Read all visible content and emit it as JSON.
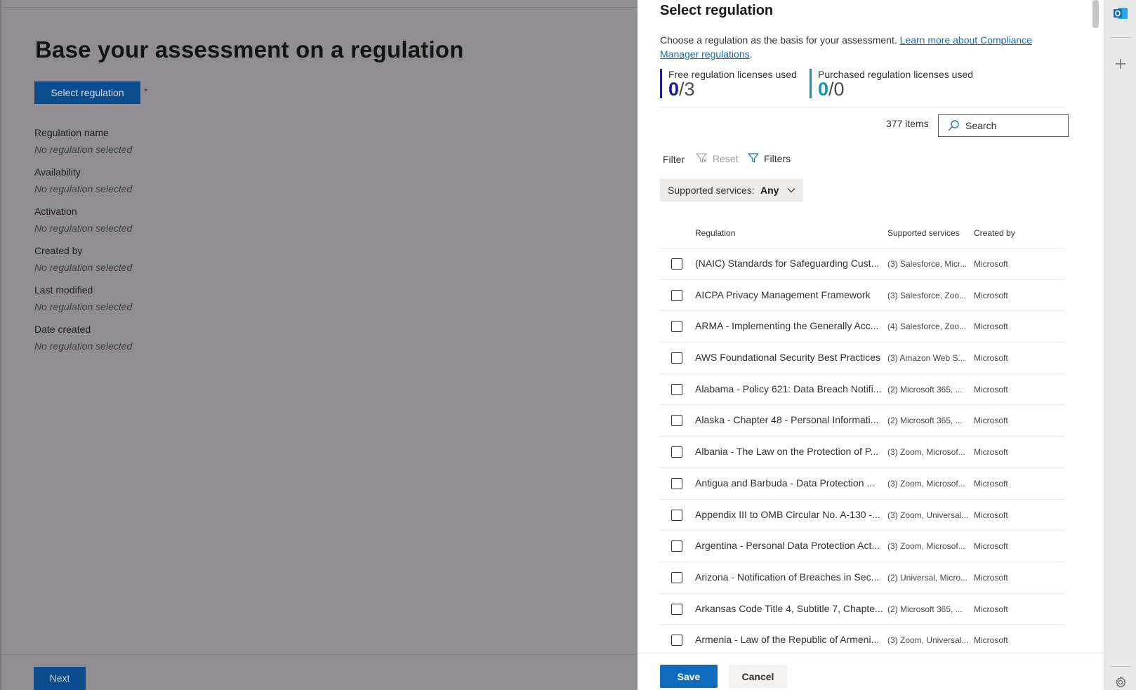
{
  "background": {
    "title": "Base your assessment on a regulation",
    "select_button": "Select regulation",
    "required_marker": "*",
    "fields": [
      {
        "label": "Regulation name",
        "value": "No regulation selected"
      },
      {
        "label": "Availability",
        "value": "No regulation selected"
      },
      {
        "label": "Activation",
        "value": "No regulation selected"
      },
      {
        "label": "Created by",
        "value": "No regulation selected"
      },
      {
        "label": "Last modified",
        "value": "No regulation selected"
      },
      {
        "label": "Date created",
        "value": "No regulation selected"
      }
    ],
    "next_button": "Next"
  },
  "panel": {
    "title": "Select regulation",
    "description": "Choose a regulation as the basis for your assessment.",
    "learn_more_link": "Learn more about Compliance Manager regulations",
    "period": ".",
    "licenses": {
      "free": {
        "label": "Free regulation licenses used",
        "used": "0",
        "total": "/3",
        "color": "#1b1a8f"
      },
      "purchased": {
        "label": "Purchased regulation licenses used",
        "used": "0",
        "total": "/0",
        "color": "#1495b3"
      }
    },
    "items_count": "377 items",
    "search_placeholder": "Search",
    "filter": {
      "label": "Filter",
      "reset": "Reset",
      "filters": "Filters"
    },
    "supported_services_dropdown": {
      "label": "Supported services:",
      "value": "Any"
    },
    "table": {
      "headers": {
        "regulation": "Regulation",
        "services": "Supported services",
        "created_by": "Created by"
      },
      "rows": [
        {
          "regulation": "(NAIC) Standards for Safeguarding Cust...",
          "services": "(3) Salesforce, Micr...",
          "created_by": "Microsoft"
        },
        {
          "regulation": "AICPA Privacy Management Framework",
          "services": "(3) Salesforce, Zoo...",
          "created_by": "Microsoft"
        },
        {
          "regulation": "ARMA - Implementing the Generally Acc...",
          "services": "(4) Salesforce, Zoo...",
          "created_by": "Microsoft"
        },
        {
          "regulation": "AWS Foundational Security Best Practices",
          "services": "(3) Amazon Web S...",
          "created_by": "Microsoft"
        },
        {
          "regulation": "Alabama - Policy 621: Data Breach Notifi...",
          "services": "(2) Microsoft 365, ...",
          "created_by": "Microsoft"
        },
        {
          "regulation": "Alaska - Chapter 48 - Personal Informati...",
          "services": "(2) Microsoft 365, ...",
          "created_by": "Microsoft"
        },
        {
          "regulation": "Albania - The Law on the Protection of P...",
          "services": "(3) Zoom, Microsof...",
          "created_by": "Microsoft"
        },
        {
          "regulation": "Antigua and Barbuda - Data Protection ...",
          "services": "(3) Zoom, Microsof...",
          "created_by": "Microsoft"
        },
        {
          "regulation": "Appendix III to OMB Circular No. A-130 -...",
          "services": "(3) Zoom, Universal...",
          "created_by": "Microsoft"
        },
        {
          "regulation": "Argentina - Personal Data Protection Act...",
          "services": "(3) Zoom, Microsof...",
          "created_by": "Microsoft"
        },
        {
          "regulation": "Arizona - Notification of Breaches in Sec...",
          "services": "(2) Universal, Micro...",
          "created_by": "Microsoft"
        },
        {
          "regulation": "Arkansas Code Title 4, Subtitle 7, Chapte...",
          "services": "(2) Microsoft 365, ...",
          "created_by": "Microsoft"
        },
        {
          "regulation": "Armenia - Law of the Republic of Armeni...",
          "services": "(3) Zoom, Universal...",
          "created_by": "Microsoft"
        }
      ]
    },
    "save_button": "Save",
    "cancel_button": "Cancel"
  },
  "rail": {
    "icons": [
      "outlook-icon",
      "plus-icon",
      "gear-icon"
    ]
  },
  "colors": {
    "accent": "#0f6cbd",
    "overlay": "#908e93"
  }
}
